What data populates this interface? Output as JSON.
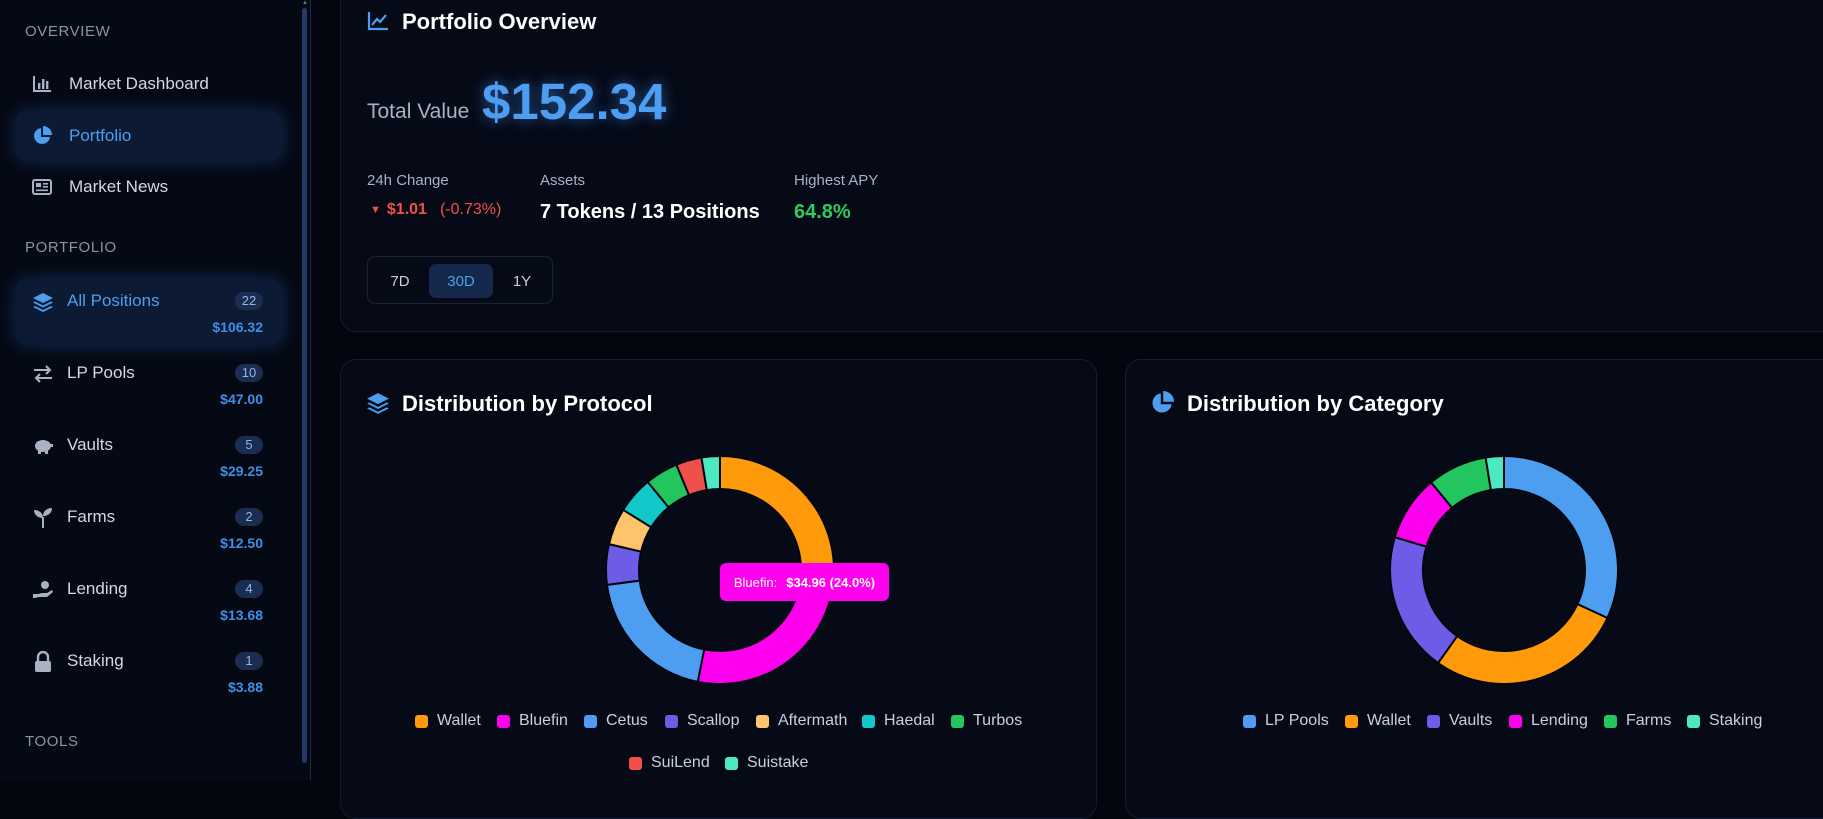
{
  "sidebar": {
    "overview_title": "OVERVIEW",
    "nav": [
      {
        "label": "Market Dashboard",
        "icon": "bar-chart-icon"
      },
      {
        "label": "Portfolio",
        "icon": "pie-chart-icon",
        "active": true
      },
      {
        "label": "Market News",
        "icon": "newspaper-icon"
      }
    ],
    "portfolio_title": "PORTFOLIO",
    "positions": [
      {
        "label": "All Positions",
        "count": "22",
        "value": "$106.32",
        "icon": "layers-icon",
        "active": true
      },
      {
        "label": "LP Pools",
        "count": "10",
        "value": "$47.00",
        "icon": "swap-arrows-icon"
      },
      {
        "label": "Vaults",
        "count": "5",
        "value": "$29.25",
        "icon": "piggy-bank-icon"
      },
      {
        "label": "Farms",
        "count": "2",
        "value": "$12.50",
        "icon": "seedling-icon"
      },
      {
        "label": "Lending",
        "count": "4",
        "value": "$13.68",
        "icon": "hand-holding-icon"
      },
      {
        "label": "Staking",
        "count": "1",
        "value": "$3.88",
        "icon": "lock-icon"
      }
    ],
    "tools_title": "TOOLS"
  },
  "overview": {
    "title": "Portfolio Overview",
    "total_label": "Total Value",
    "total_value": "$152.34",
    "change_label": "24h Change",
    "change_amount": "$1.01",
    "change_percent": "(-0.73%)",
    "assets_label": "Assets",
    "assets_value": "7 Tokens / 13 Positions",
    "apy_label": "Highest APY",
    "apy_value": "64.8%",
    "ranges": [
      "7D",
      "30D",
      "1Y"
    ],
    "active_range": "30D"
  },
  "protocol_card": {
    "title": "Distribution by Protocol",
    "tooltip_label": "Bluefin:",
    "tooltip_value": "$34.96 (24.0%)"
  },
  "category_card": {
    "title": "Distribution by Category"
  },
  "colors": {
    "accent": "#4d9ef0",
    "negative": "#f0504a",
    "positive": "#2ecc5a"
  },
  "chart_data": [
    {
      "type": "pie",
      "title": "Distribution by Protocol",
      "categories": [
        "Wallet",
        "Bluefin",
        "Cetus",
        "Scallop",
        "Aftermath",
        "Haedal",
        "Turbos",
        "SuiLend",
        "Suistake"
      ],
      "values": [
        27.0,
        24.0,
        19.0,
        5.5,
        5.0,
        5.0,
        4.5,
        3.5,
        2.5
      ],
      "colors": [
        "#ff9a0a",
        "#ff00ee",
        "#4d9ef0",
        "#6d5ce6",
        "#ffc46b",
        "#12c8c8",
        "#22c55e",
        "#f0504a",
        "#4de8c2"
      ],
      "legend": "bottom"
    },
    {
      "type": "pie",
      "title": "Distribution by Category",
      "categories": [
        "LP Pools",
        "Wallet",
        "Vaults",
        "Lending",
        "Farms",
        "Staking"
      ],
      "values": [
        30.9,
        27.0,
        19.2,
        9.0,
        8.2,
        2.5
      ],
      "colors": [
        "#4d9ef0",
        "#ff9a0a",
        "#6d5ce6",
        "#ff00ee",
        "#22c55e",
        "#4de8c2"
      ],
      "legend": "bottom"
    }
  ]
}
